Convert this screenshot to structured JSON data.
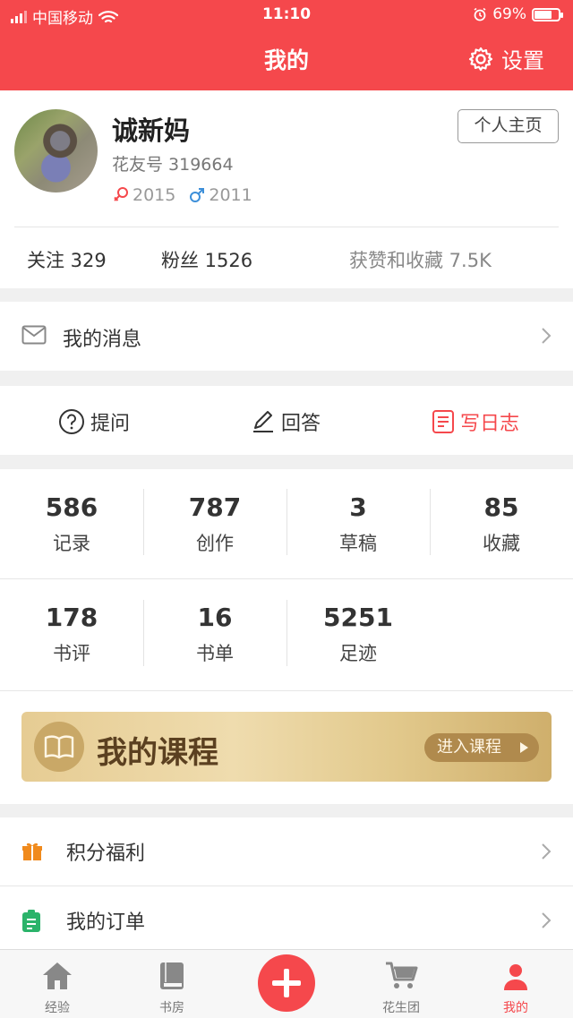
{
  "status_bar": {
    "carrier": "中国移动",
    "time": "11:10",
    "battery": "69%"
  },
  "header": {
    "title": "我的",
    "settings_label": "设置"
  },
  "profile": {
    "name": "诚新妈",
    "huayou_id": "花友号 319664",
    "kids": [
      {
        "gender": "female",
        "year": "2015"
      },
      {
        "gender": "male",
        "year": "2011"
      }
    ],
    "homepage_button": "个人主页",
    "following": "关注 329",
    "followers": "粉丝 1526",
    "likes": "获赞和收藏 7.5K"
  },
  "messages": {
    "label": "我的消息"
  },
  "actions": {
    "ask": "提问",
    "answer": "回答",
    "write_diary": "写日志"
  },
  "counts": [
    {
      "value": "586",
      "label": "记录"
    },
    {
      "value": "787",
      "label": "创作"
    },
    {
      "value": "3",
      "label": "草稿"
    },
    {
      "value": "85",
      "label": "收藏"
    },
    {
      "value": "178",
      "label": "书评"
    },
    {
      "value": "16",
      "label": "书单"
    },
    {
      "value": "5251",
      "label": "足迹"
    }
  ],
  "course": {
    "title": "我的课程",
    "enter": "进入课程"
  },
  "menu": [
    {
      "label": "积分福利",
      "icon": "gift-icon"
    },
    {
      "label": "我的订单",
      "icon": "order-icon"
    }
  ],
  "tabbar": [
    {
      "label": "经验",
      "icon": "home-icon"
    },
    {
      "label": "书房",
      "icon": "book-icon"
    },
    {
      "label": "",
      "icon": "plus-icon"
    },
    {
      "label": "花生团",
      "icon": "cart-icon"
    },
    {
      "label": "我的",
      "icon": "user-icon"
    }
  ],
  "colors": {
    "brand": "#f5484c",
    "female": "#f5484c",
    "male": "#3d8fd9",
    "gift": "#f08a1c",
    "order": "#2bb36a"
  }
}
